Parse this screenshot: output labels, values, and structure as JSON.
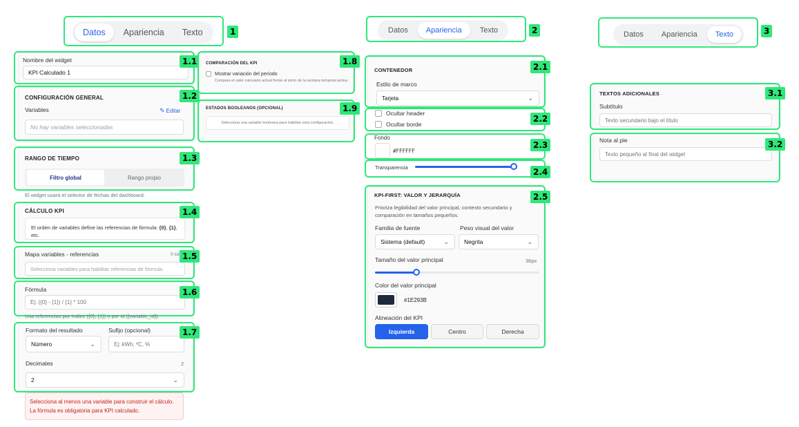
{
  "panel1": {
    "tabs": [
      "Datos",
      "Apariencia",
      "Texto"
    ],
    "active_tab": "Datos",
    "badges": [
      "1",
      "1.1",
      "1.2",
      "1.3",
      "1.4",
      "1.5",
      "1.6",
      "1.7",
      "1.8",
      "1.9"
    ],
    "widget_name": {
      "label": "Nombre del widget",
      "value": "KPI Calculado 1"
    },
    "general": {
      "title": "CONFIGURACIÓN GENERAL",
      "variables_label": "Variables",
      "edit_label": "Editar",
      "empty_placeholder": "No hay variables seleccionadas"
    },
    "time_range": {
      "title": "RANGO DE TIEMPO",
      "options": [
        "Filtro global",
        "Rango propio"
      ],
      "hint": "El widget usará el selector de fechas del dashboard."
    },
    "kpi_calc": {
      "title": "CÁLCULO KPI",
      "info_prefix": "El orden de variables define las referencias de fórmula: ",
      "ref_a": "{0}",
      "ref_sep": ", ",
      "ref_b": "{1}",
      "info_suffix": ", etc."
    },
    "var_map": {
      "label": "Mapa variables - referencias",
      "count": "0 total",
      "placeholder": "Selecciona variables para habilitar referencias de fórmula."
    },
    "formula": {
      "label": "Fórmula",
      "placeholder": "Ej: ({0} - {1}) / {1} * 100",
      "hint": "Usa referencias por índice ({0}, {1}) o por id ({variable_id})."
    },
    "result": {
      "format_label": "Formato del resultado",
      "format_value": "Número",
      "suffix_label": "Sufijo (opcional)",
      "suffix_placeholder": "Ej: kWh, ºC, %",
      "decimals_label": "Decimales",
      "decimals_count": "2",
      "decimals_value": "2"
    },
    "errors": [
      "Selecciona al menos una variable para construir el cálculo.",
      "La fórmula es obligatoria para KPI calculado."
    ],
    "comparison": {
      "title": "COMPARACIÓN DEL KPI",
      "checkbox_label": "Mostrar variación del período",
      "description": "Compara el valor calculado actual frente al inicio de la ventana temporal activa."
    },
    "booleans": {
      "title": "ESTADOS BOOLEANOS (OPCIONAL)",
      "hint": "Selecciona una variable booleana para habilitar esta configuración."
    }
  },
  "panel2": {
    "tabs": [
      "Datos",
      "Apariencia",
      "Texto"
    ],
    "active_tab": "Apariencia",
    "badges": [
      "2",
      "2.1",
      "2.2",
      "2.3",
      "2.4",
      "2.5"
    ],
    "container": {
      "title": "CONTENEDOR",
      "frame_label": "Estilo de marco",
      "frame_value": "Tarjeta"
    },
    "toggles": [
      "Ocultar header",
      "Ocultar borde"
    ],
    "background": {
      "label": "Fondo",
      "value": "#FFFFFF"
    },
    "transparency": {
      "label": "Transparencia",
      "value_fraction": 1.0
    },
    "kpi_first": {
      "title": "KPI-FIRST: VALOR Y JERARQUÍA",
      "description": "Prioriza legibilidad del valor principal, contexto secundario y comparación en tamaños pequeños.",
      "font_family_label": "Familia de fuente",
      "font_family_value": "Sistema (default)",
      "weight_label": "Peso visual del valor",
      "weight_value": "Negrita",
      "size_label": "Tamaño del valor principal",
      "size_value": "36px",
      "size_fraction": 0.25,
      "color_label": "Color del valor principal",
      "color_value": "#1E293B",
      "align_label": "Alineación del KPI",
      "align_options": [
        "Izquierda",
        "Centro",
        "Derecha"
      ],
      "align_active": "Izquierda"
    }
  },
  "panel3": {
    "tabs": [
      "Datos",
      "Apariencia",
      "Texto"
    ],
    "active_tab": "Texto",
    "badges": [
      "3",
      "3.1",
      "3.2"
    ],
    "extra_texts": {
      "title": "TEXTOS ADICIONALES",
      "subtitle_label": "Subtítulo",
      "subtitle_placeholder": "Texto secundario bajo el título"
    },
    "footnote": {
      "label": "Nota al pie",
      "placeholder": "Texto pequeño al final del widget"
    }
  },
  "colors": {
    "highlight": "#2ee87a",
    "accent": "#2563eb",
    "error": "#c2271d",
    "value_color": "#1E293B"
  }
}
